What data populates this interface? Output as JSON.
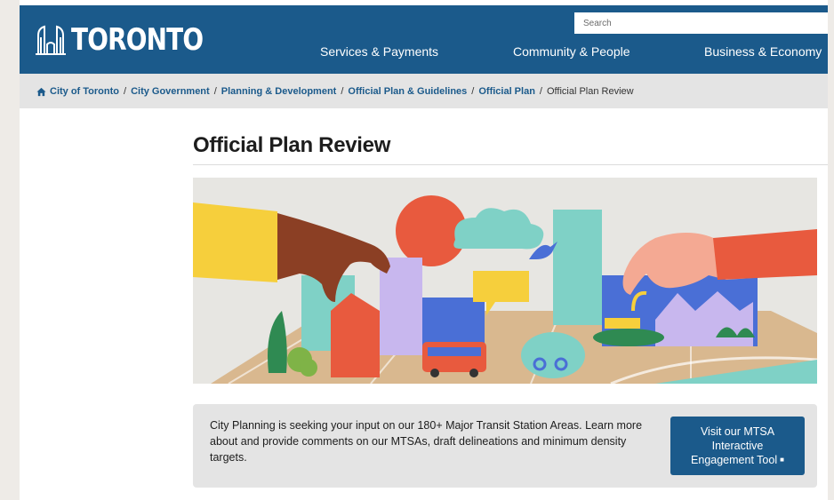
{
  "header": {
    "logo_text": "TORONTO",
    "search_placeholder": "Search",
    "nav": [
      "Services & Payments",
      "Community & People",
      "Business & Economy"
    ],
    "bg_color": "#1b5a8b"
  },
  "breadcrumb": {
    "items": [
      "City of Toronto",
      "City Government",
      "Planning & Development",
      "Official Plan & Guidelines",
      "Official Plan"
    ],
    "current": "Official Plan Review",
    "separator": "/"
  },
  "main": {
    "title": "Official Plan Review",
    "hero_image": "city-planning-illustration",
    "notice": {
      "text": "City Planning is seeking your input on our 180+ Major Transit Station Areas. Learn more about and provide comments on our MTSAs, draft delineations and minimum density targets.",
      "button_lines": [
        "Visit our MTSA",
        "Interactive",
        "Engagement Tool"
      ],
      "button_icon": "external-link-icon"
    }
  }
}
